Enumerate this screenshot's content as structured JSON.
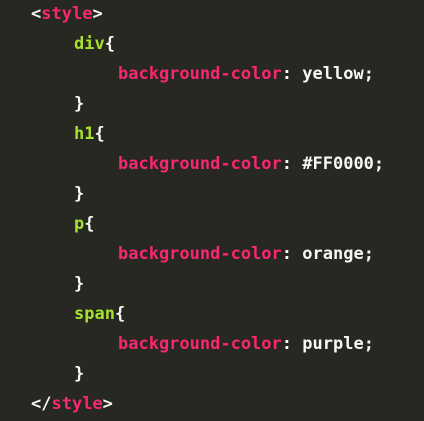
{
  "colors": {
    "background": "#272822",
    "tag": "#f92672",
    "punctuation": "#f8f8f2",
    "selector": "#a6e22e",
    "property": "#f92672",
    "value": "#f8f8f2"
  },
  "code": {
    "style_open": {
      "lt": "<",
      "name": "style",
      "gt": ">"
    },
    "rules": [
      {
        "selector": "div",
        "open": "{",
        "property": "background-color",
        "colon": ":",
        "value": "yellow",
        "semicolon": ";",
        "close": "}"
      },
      {
        "selector": "h1",
        "open": "{",
        "property": "background-color",
        "colon": ":",
        "value": "#FF0000",
        "semicolon": ";",
        "close": "}"
      },
      {
        "selector": "p",
        "open": "{",
        "property": "background-color",
        "colon": ":",
        "value": "orange",
        "semicolon": ";",
        "close": "}"
      },
      {
        "selector": "span",
        "open": "{",
        "property": "background-color",
        "colon": ":",
        "value": "purple",
        "semicolon": ";",
        "close": "}"
      }
    ],
    "style_close": {
      "lt": "</",
      "name": "style",
      "gt": ">"
    }
  }
}
